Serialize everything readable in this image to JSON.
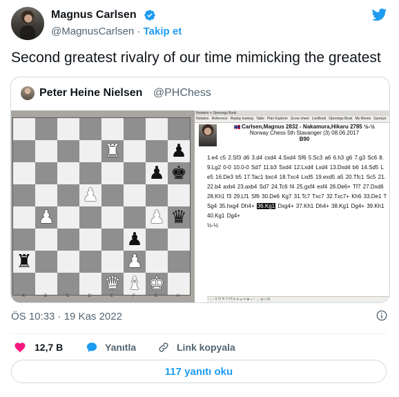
{
  "author": {
    "name": "Magnus Carlsen",
    "handle": "@MagnusCarlsen",
    "separator": " · ",
    "follow": "Takip et"
  },
  "tweet": {
    "text": "Second greatest rivalry of our time mimicking the greatest"
  },
  "quoted": {
    "name": "Peter Heine Nielsen",
    "handle": "@PHChess",
    "menubar": "Notation + Openings Book",
    "tabs": [
      "Notation",
      "Reference",
      "Replay training",
      "Table",
      "Plan Explorer",
      "Score sheet",
      "LiveBook",
      "Openings Book",
      "My Moves",
      "Surveys"
    ],
    "game_header": "Carlsen,Magnus 2832 - Nakamura,Hikaru 2785 ½-½",
    "event": "Norway Chess 5th Stavanger (3) 08.06.2017",
    "eco": "B90",
    "moves_before": "1.e4 c5 2.Sf3 d6 3.d4 cxd4 4.Sxd4 Sf6 5.Sc3 a6 6.h3 g6 7.g3 Sc6 8. 9.Lg2 0-0 10.0-0 Sd7 11.b3 Sxd4 12.Lxd4 Lxd4 13.Dxd4 b6 14.Sd5 L e5 16.De3 b5 17.Tac1 bxc4 18.Txc4 Lxd5 19.exd5 a5 20.Tfc1 Sc5 21. 22.b4 axb4 23.axb4 Sd7 24.Tc6 f4 25.gxf4 exf4 26.De6+ Tf7 27.Dxd6 28.Kh1 f3 29.Lf1 Sf6 30.De6 Kg7 31.Tc7 Txc7 32.Txc7+ Kh6 33.De1 T Sg4 35.hxg4 Dh4+",
    "move_highlight": "36.Kg1",
    "moves_after": "Dxg4+ 37.Kh1 Dh4+ 38.Kg1 Dg4+ 39.Kh1 40.Kg1 Dg4+",
    "result": "½-½",
    "toolbar_text": "↑ ↑ ↑ !! !? ?! ? ?? ±  ∓ ∞ = ⊕ ○ ↑ → ⇄ □ N",
    "board": {
      "files": [
        "A",
        "B",
        "C",
        "D",
        "E",
        "F",
        "G",
        "H"
      ],
      "rows": [
        [
          "",
          "",
          "",
          "",
          "",
          "",
          "",
          ""
        ],
        [
          "",
          "",
          "",
          "",
          "wR",
          "",
          "",
          "bP"
        ],
        [
          "",
          "",
          "",
          "",
          "",
          "",
          "bP",
          "bK"
        ],
        [
          "",
          "",
          "",
          "wP",
          "",
          "",
          "",
          ""
        ],
        [
          "",
          "wP",
          "",
          "",
          "",
          "",
          "wP",
          "bQ"
        ],
        [
          "",
          "",
          "",
          "",
          "",
          "bP",
          "",
          ""
        ],
        [
          "bR",
          "",
          "",
          "",
          "",
          "wP",
          "",
          ""
        ],
        [
          "",
          "",
          "",
          "",
          "wQ",
          "wB",
          "wK",
          ""
        ]
      ]
    }
  },
  "meta": {
    "time": "ÖS 10:33 · 19 Kas 2022"
  },
  "actions": {
    "likes": "12,7 B",
    "reply": "Yanıtla",
    "copy_link": "Link kopyala",
    "read_replies": "117 yanıtı oku"
  },
  "colors": {
    "accent": "#1d9bf0",
    "like": "#f91880",
    "muted": "#536471"
  }
}
